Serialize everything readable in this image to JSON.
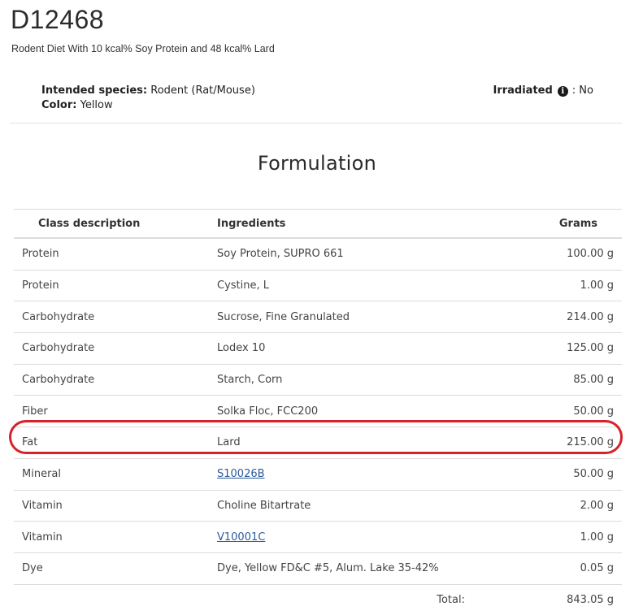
{
  "header": {
    "code": "D12468",
    "subtitle": "Rodent Diet With 10 kcal% Soy Protein and 48 kcal% Lard"
  },
  "meta": {
    "species_label": "Intended species:",
    "species_value": "Rodent (Rat/Mouse)",
    "color_label": "Color:",
    "color_value": "Yellow",
    "irradiated_label": "Irradiated",
    "irradiated_value": ": No",
    "info_icon": "info-circle-icon"
  },
  "section": {
    "title": "Formulation"
  },
  "table": {
    "columns": [
      "Class description",
      "Ingredients",
      "Grams"
    ],
    "rows": [
      {
        "class": "Protein",
        "ingredient": "Soy Protein, SUPRO 661",
        "grams": "100.00 g",
        "link": false
      },
      {
        "class": "Protein",
        "ingredient": "Cystine, L",
        "grams": "1.00 g",
        "link": false
      },
      {
        "class": "Carbohydrate",
        "ingredient": "Sucrose, Fine Granulated",
        "grams": "214.00 g",
        "link": false
      },
      {
        "class": "Carbohydrate",
        "ingredient": "Lodex 10",
        "grams": "125.00 g",
        "link": false
      },
      {
        "class": "Carbohydrate",
        "ingredient": "Starch, Corn",
        "grams": "85.00 g",
        "link": false
      },
      {
        "class": "Fiber",
        "ingredient": "Solka Floc, FCC200",
        "grams": "50.00 g",
        "link": false
      },
      {
        "class": "Fat",
        "ingredient": "Lard",
        "grams": "215.00 g",
        "link": false
      },
      {
        "class": "Mineral",
        "ingredient": "S10026B",
        "grams": "50.00 g",
        "link": true
      },
      {
        "class": "Vitamin",
        "ingredient": "Choline Bitartrate",
        "grams": "2.00 g",
        "link": false
      },
      {
        "class": "Vitamin",
        "ingredient": "V10001C",
        "grams": "1.00 g",
        "link": true
      },
      {
        "class": "Dye",
        "ingredient": "Dye, Yellow FD&C #5, Alum. Lake 35-42%",
        "grams": "0.05 g",
        "link": false
      }
    ],
    "total_label": "Total:",
    "total_value": "843.05 g"
  },
  "colors": {
    "highlight": "#d7222b",
    "link": "#2a5b9c"
  }
}
